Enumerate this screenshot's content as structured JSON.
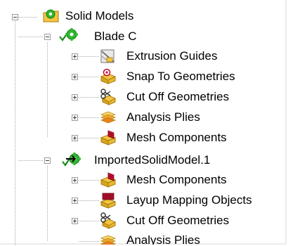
{
  "tree": {
    "root": {
      "label": "Solid Models",
      "icon": "solid-models-folder-icon"
    },
    "models": [
      {
        "label": "Blade C",
        "icon": "solid-model-gear-check-icon",
        "children": [
          {
            "label": "Extrusion Guides",
            "icon": "extrusion-guides-icon"
          },
          {
            "label": "Snap To Geometries",
            "icon": "snap-to-geometry-icon"
          },
          {
            "label": "Cut Off Geometries",
            "icon": "cut-off-geometry-icon"
          },
          {
            "label": "Analysis Plies",
            "icon": "analysis-plies-icon"
          },
          {
            "label": "Mesh Components",
            "icon": "mesh-components-icon"
          }
        ]
      },
      {
        "label": "ImportedSolidModel.1",
        "icon": "imported-solid-model-icon",
        "children": [
          {
            "label": "Mesh Components",
            "icon": "mesh-components-icon"
          },
          {
            "label": "Layup Mapping Objects",
            "icon": "layup-mapping-objects-icon"
          },
          {
            "label": "Cut Off Geometries",
            "icon": "cut-off-geometry-icon"
          },
          {
            "label": "Analysis Plies",
            "icon": "analysis-plies-icon"
          }
        ]
      }
    ]
  },
  "colors": {
    "tree_line": "#a9a9a9",
    "gear_green": "#2fb82f",
    "check_green": "#1a8a1a",
    "folder_yellow": "#f4c542",
    "accent_red": "#c8102e"
  }
}
